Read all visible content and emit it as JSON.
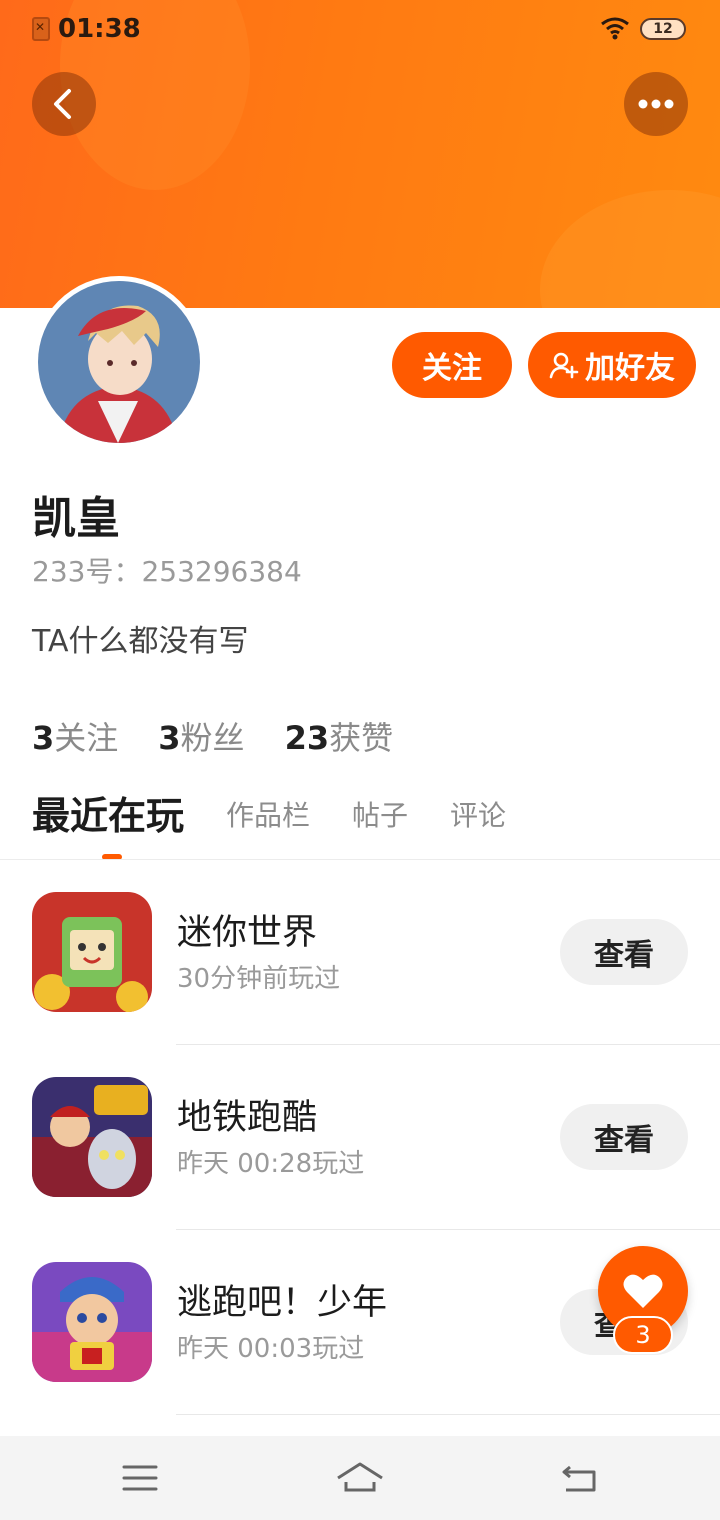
{
  "status_bar": {
    "time": "01:38",
    "battery": "12"
  },
  "header": {
    "back_icon": "chevron-left-icon",
    "more_icon": "more-horizontal-icon"
  },
  "profile": {
    "name": "凯皇",
    "uid": "233号：253296384",
    "bio": "TA什么都没有写",
    "follow_label": "关注",
    "add_friend_label": "加好友",
    "stats": [
      {
        "num": "3",
        "label": "关注"
      },
      {
        "num": "3",
        "label": "粉丝"
      },
      {
        "num": "23",
        "label": "获赞"
      }
    ]
  },
  "tabs": [
    "最近在玩",
    "作品栏",
    "帖子",
    "评论"
  ],
  "games": [
    {
      "title": "迷你世界",
      "time": "30分钟前玩过",
      "action": "查看"
    },
    {
      "title": "地铁跑酷",
      "time": "昨天 00:28玩过",
      "action": "查看"
    },
    {
      "title": "逃跑吧！少年",
      "time": "昨天 00:03玩过",
      "action": "查看"
    }
  ],
  "like": {
    "count": "3"
  },
  "colors": {
    "accent": "#ff5a00",
    "banner": "#ff7a12"
  }
}
